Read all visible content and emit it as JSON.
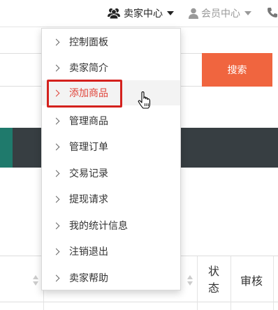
{
  "topbar": {
    "seller_center": "卖家中心",
    "member_center": "会员中心"
  },
  "search": {
    "placeholder": "",
    "button_label": "搜索"
  },
  "dropdown": {
    "items": [
      {
        "label": "控制面板"
      },
      {
        "label": "卖家简介"
      },
      {
        "label": "添加商品"
      },
      {
        "label": "管理商品"
      },
      {
        "label": "管理订单"
      },
      {
        "label": "交易记录"
      },
      {
        "label": "提现请求"
      },
      {
        "label": "我的统计信息"
      },
      {
        "label": "注销退出"
      },
      {
        "label": "卖家帮助"
      }
    ],
    "active_item": "添加商品"
  },
  "table": {
    "headers": [
      "状态",
      "审核"
    ]
  },
  "colors": {
    "search_button": "#f0653f",
    "nav_band": "#373e42",
    "nav_accent": "#1f7a6c",
    "active_text": "#e0443a",
    "highlight_border": "#d4211d"
  },
  "icons": [
    "users-icon",
    "user-icon",
    "phone-icon",
    "chevron-right-icon",
    "hand-pointer-icon",
    "sort-icon"
  ]
}
